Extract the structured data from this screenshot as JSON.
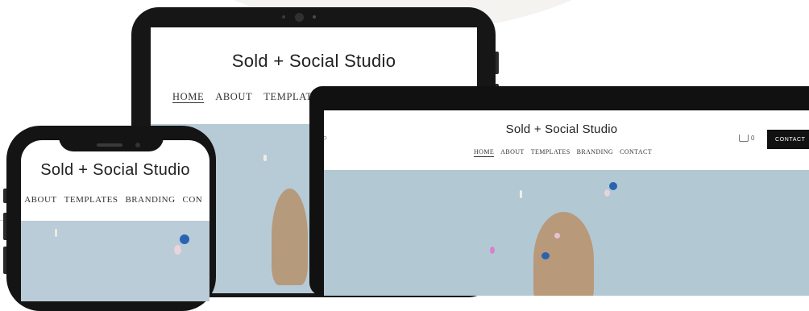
{
  "site": {
    "title": "Sold + Social Studio"
  },
  "tablet": {
    "nav": [
      "HOME",
      "ABOUT",
      "TEMPLATES"
    ]
  },
  "laptop": {
    "nav": [
      "HOME",
      "ABOUT",
      "TEMPLATES",
      "BRANDING",
      "CONTACT"
    ],
    "cart_count": "0",
    "cta_label": "CONTACT"
  },
  "phone": {
    "nav": [
      "E",
      "ABOUT",
      "TEMPLATES",
      "BRANDING",
      "CON"
    ]
  },
  "colors": {
    "hero_bg": "#b2c8d3",
    "device_frame": "#141414",
    "cta_bg": "#111111"
  }
}
